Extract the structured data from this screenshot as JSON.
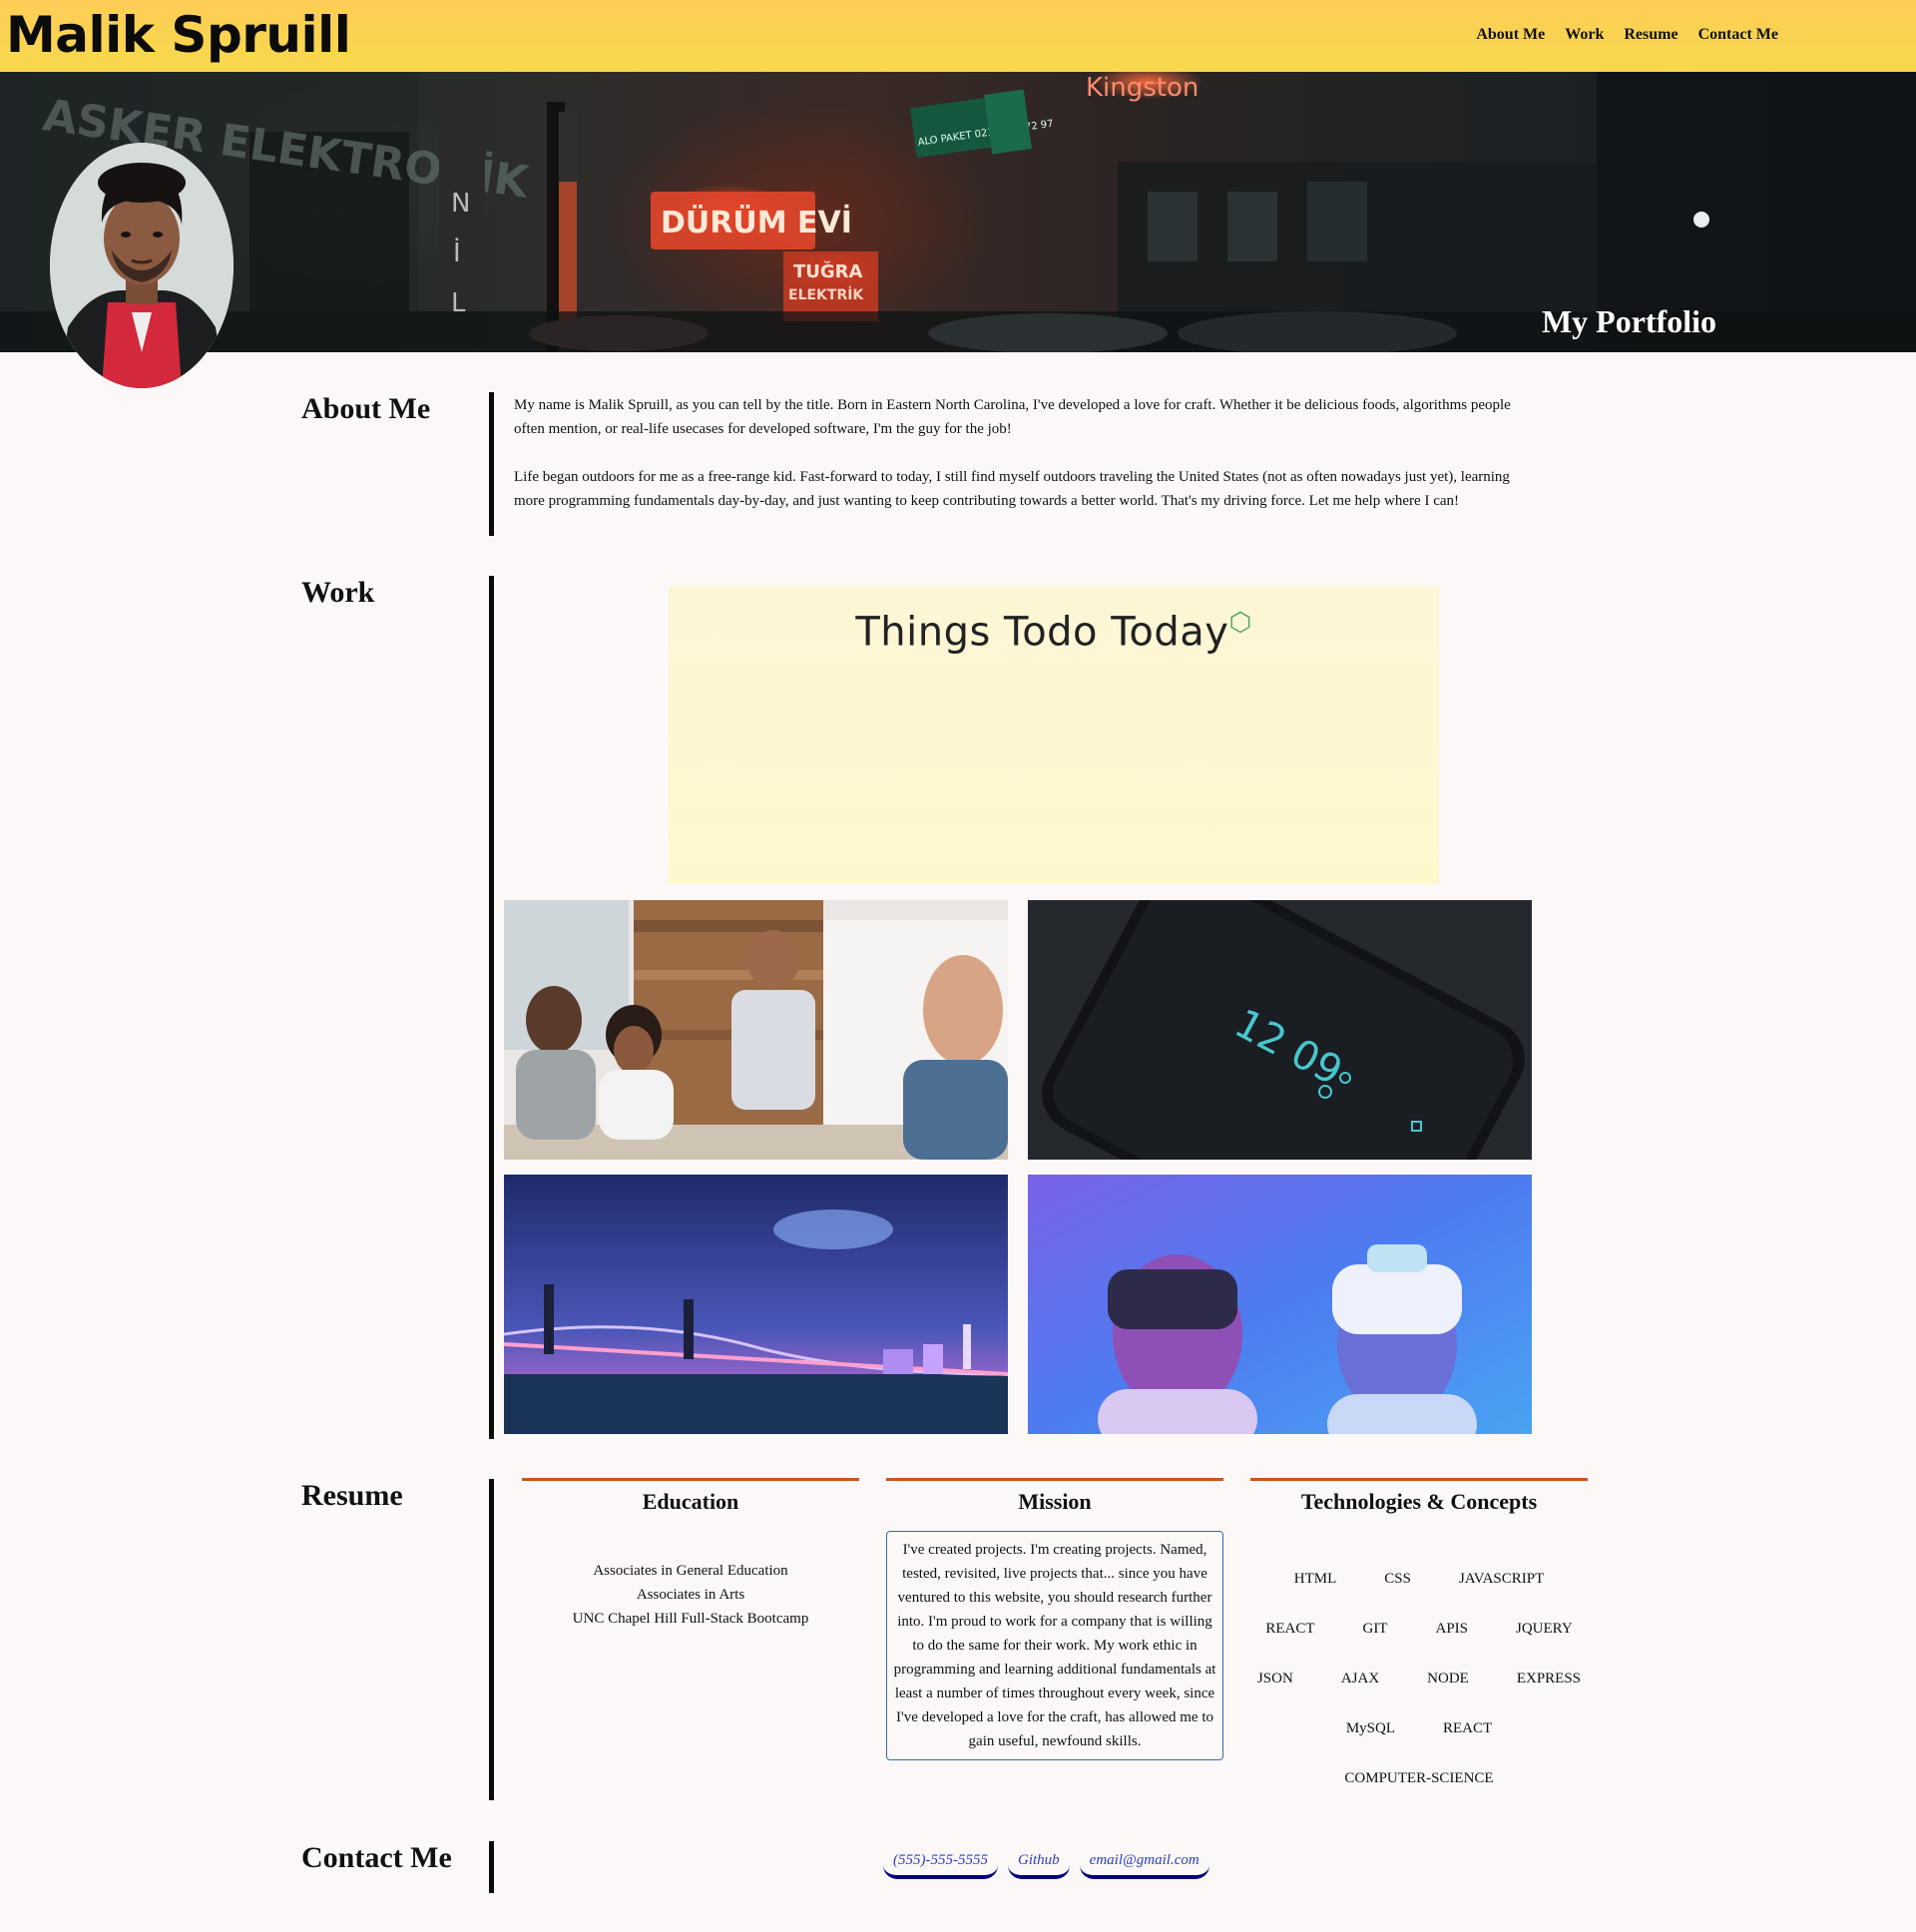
{
  "header": {
    "brand": "Malik Spruill",
    "nav": [
      "About Me",
      "Work",
      "Resume",
      "Contact Me"
    ]
  },
  "hero": {
    "title": "My Portfolio",
    "signs": [
      "Kingston",
      "DÜRÜM EVİ",
      "TUĞRA",
      "ELEKTRİK",
      "ASKER ELEKTRONİK",
      "ALO PAKET 0212 429 72 97"
    ]
  },
  "about": {
    "heading": "About  Me",
    "paragraphs": [
      "My name is Malik Spruill, as you can tell by the title. Born in Eastern North Carolina, I've developed a love for craft. Whether it be delicious foods, algorithms people often mention, or real-life usecases for developed software, I'm the guy for the job!",
      "Life began outdoors for me as a free-range kid. Fast-forward to today, I still find myself outdoors traveling the United States (not as often nowadays just yet), learning more programming fundamentals day-by-day, and just wanting to keep contributing towards a better world. That's my driving force. Let me help where I can!"
    ]
  },
  "work": {
    "heading": "Work",
    "featured_title": "Things Todo Today",
    "phone_clock": "12 09"
  },
  "resume": {
    "heading": "Resume",
    "education": {
      "title": "Education",
      "items": [
        "Associates in General Education",
        "Associates in Arts",
        "UNC Chapel Hill Full-Stack Bootcamp"
      ]
    },
    "mission": {
      "title": "Mission",
      "text": "I've created projects. I'm creating projects. Named, tested, revisited, live projects that... since you have ventured to this website, you should research further into. I'm proud to work for a company that is willing to do the same for their work. My work ethic in programming and learning additional fundamentals at least a number of times throughout every week, since I've developed a love for the craft, has allowed me to gain useful, newfound skills."
    },
    "tech": {
      "title": "Technologies & Concepts",
      "items": [
        "HTML",
        "CSS",
        "JAVASCRIPT",
        "REACT",
        "GIT",
        "APIS",
        "JQUERY",
        "JSON",
        "AJAX",
        "NODE",
        "EXPRESS",
        "MySQL",
        "REACT",
        "COMPUTER-SCIENCE"
      ]
    }
  },
  "contact": {
    "heading": "Contact Me",
    "links": [
      "(555)-555-5555",
      "Github",
      "email@gmail.com"
    ]
  },
  "colors": {
    "header_gradient_top": "#fdcd57",
    "header_gradient_bottom": "#f7d94c",
    "resume_accent": "#c9551f",
    "link": "#2b3cc7",
    "link_underline": "#00007a"
  }
}
